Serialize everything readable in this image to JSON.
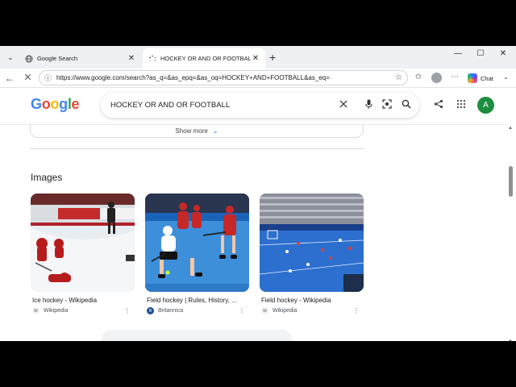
{
  "browser": {
    "tabs": [
      {
        "title": "Google Search",
        "favicon": "globe-icon"
      },
      {
        "title": "HOCKEY OR AND OR FOOTBALL",
        "favicon": "loading-icon"
      }
    ],
    "url": "https://www.google.com/search?as_q=&as_epq=&as_oq=HOCKEY+AND+FOOTBALL&as_eq=",
    "chat_label": "Chat"
  },
  "google": {
    "logo_letters": [
      "G",
      "o",
      "o",
      "g",
      "l",
      "e"
    ],
    "logo_colors": [
      "#4285F4",
      "#EA4335",
      "#FBBC05",
      "#4285F4",
      "#34A853",
      "#EA4335"
    ],
    "query": "HOCKEY OR AND OR FOOTBALL",
    "avatar_letter": "A",
    "show_more_label": "Show more",
    "images_heading": "Images",
    "images": [
      {
        "title": "Ice hockey - Wikipedia",
        "source": "Wikipedia",
        "source_icon": "W"
      },
      {
        "title": "Field hockey | Rules, History, ...",
        "source": "Britannica",
        "source_icon": "B"
      },
      {
        "title": "Field hockey - Wikipedia",
        "source": "Wikipedia",
        "source_icon": "W"
      }
    ]
  },
  "colors": {
    "accent": "#1a73e8",
    "avatar": "#1e8e3e"
  }
}
